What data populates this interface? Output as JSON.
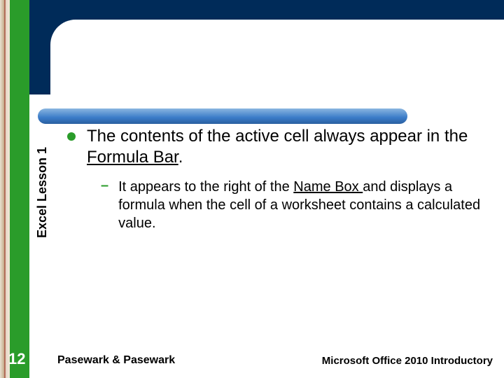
{
  "sidebar": {
    "vertical_label": "Excel Lesson 1",
    "page_number": "12"
  },
  "content": {
    "main_bullet_pre": "The contents of the active cell always appear in the ",
    "main_bullet_u": "Formula Bar",
    "main_bullet_post": ".",
    "sub_bullet_pre": "It appears to the right of the ",
    "sub_bullet_u": "Name Box ",
    "sub_bullet_post": "and displays a formula when the cell of a worksheet contains a calculated value."
  },
  "footer": {
    "left": "Pasewark & Pasewark",
    "right": "Microsoft Office 2010 Introductory"
  }
}
